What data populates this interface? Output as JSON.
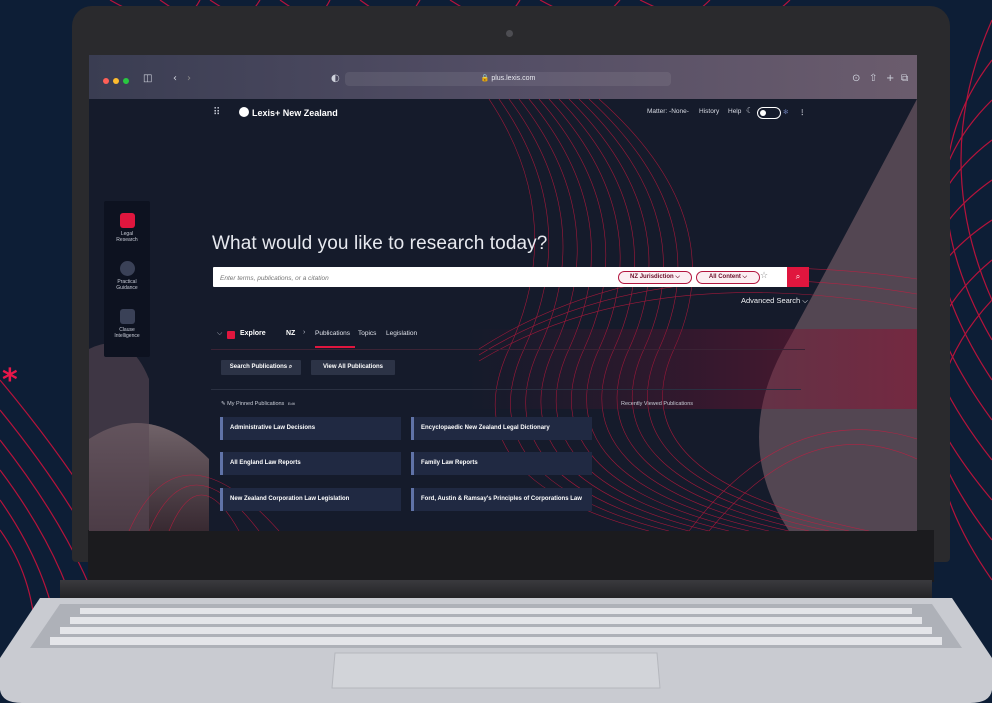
{
  "browser": {
    "url": "plus.lexis.com"
  },
  "header": {
    "brand": "Lexis+ New Zealand",
    "matter": "Matter: -None-",
    "history": "History",
    "help": "Help"
  },
  "rail": {
    "items": [
      {
        "line1": "Legal",
        "line2": "Research"
      },
      {
        "line1": "Practical",
        "line2": "Guidance"
      },
      {
        "line1": "Clause",
        "line2": "Intelligence"
      }
    ]
  },
  "hero": {
    "headline": "What would you like to research today?",
    "search_placeholder": "Enter terms, publications, or a citation",
    "jurisdiction": "NZ Jurisdiction ⌵",
    "content": "All Content ⌵",
    "advanced": "Advanced Search ⌵"
  },
  "explore": {
    "title": "Explore",
    "region": "NZ",
    "tabs": [
      "Publications",
      "Topics",
      "Legislation"
    ]
  },
  "actions": {
    "search_publications": "Search Publications",
    "view_all": "View All Publications"
  },
  "pinned": {
    "label": "My Pinned Publications",
    "edit": "Edit",
    "items": [
      "Administrative Law Decisions",
      "Encyclopaedic New Zealand Legal Dictionary",
      "All England Law Reports",
      "Family Law Reports",
      "New Zealand Corporation Law Legislation",
      "Ford, Austin & Ramsay's Principles of Corporations Law"
    ]
  },
  "recent": {
    "label": "Recently Viewed Publications"
  },
  "colors": {
    "accent": "#e0163e",
    "navy": "#0d1e36",
    "card": "#202942"
  }
}
